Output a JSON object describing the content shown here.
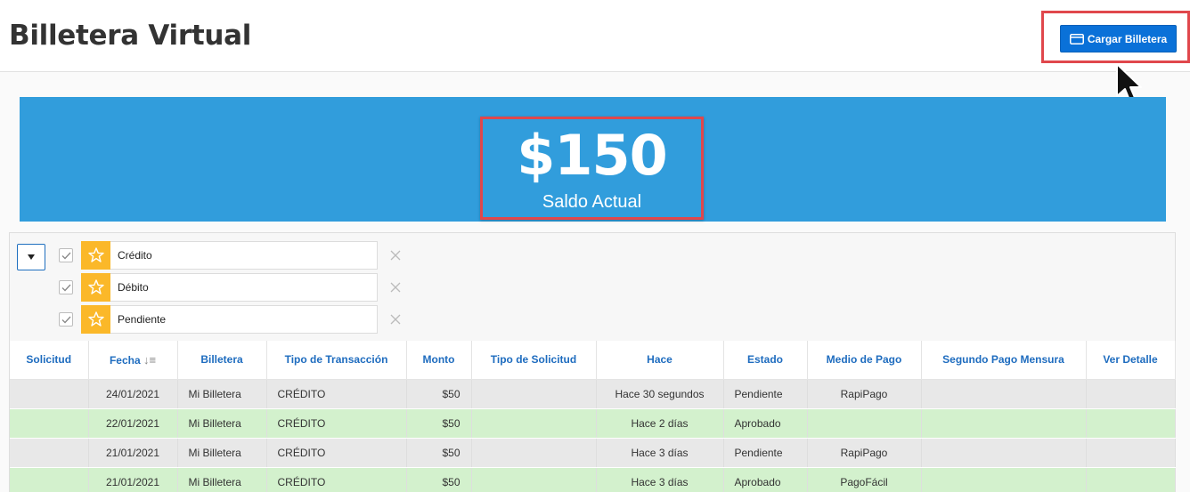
{
  "header": {
    "title": "Billetera Virtual",
    "cta_label": "Cargar Billetera"
  },
  "balance": {
    "amount": "$150",
    "label": "Saldo Actual"
  },
  "filters": [
    {
      "label": "Crédito"
    },
    {
      "label": "Débito"
    },
    {
      "label": "Pendiente"
    }
  ],
  "table": {
    "columns": [
      "Solicitud",
      "Fecha",
      "Billetera",
      "Tipo de Transacción",
      "Monto",
      "Tipo de Solicitud",
      "Hace",
      "Estado",
      "Medio de Pago",
      "Segundo Pago Mensura",
      "Ver Detalle"
    ],
    "rows": [
      {
        "solicitud": "",
        "fecha": "24/01/2021",
        "billetera": "Mi Billetera",
        "tipo": "CRÉDITO",
        "monto": "$50",
        "tipo_solicitud": "",
        "hace": "Hace 30 segundos",
        "estado": "Pendiente",
        "medio": "RapiPago",
        "segundo": "",
        "detalle": ""
      },
      {
        "solicitud": "",
        "fecha": "22/01/2021",
        "billetera": "Mi Billetera",
        "tipo": "CRÉDITO",
        "monto": "$50",
        "tipo_solicitud": "",
        "hace": "Hace 2 días",
        "estado": "Aprobado",
        "medio": "",
        "segundo": "",
        "detalle": ""
      },
      {
        "solicitud": "",
        "fecha": "21/01/2021",
        "billetera": "Mi Billetera",
        "tipo": "CRÉDITO",
        "monto": "$50",
        "tipo_solicitud": "",
        "hace": "Hace 3 días",
        "estado": "Pendiente",
        "medio": "RapiPago",
        "segundo": "",
        "detalle": ""
      },
      {
        "solicitud": "",
        "fecha": "21/01/2021",
        "billetera": "Mi Billetera",
        "tipo": "CRÉDITO",
        "monto": "$50",
        "tipo_solicitud": "",
        "hace": "Hace 3 días",
        "estado": "Aprobado",
        "medio": "PagoFácil",
        "segundo": "",
        "detalle": ""
      }
    ]
  },
  "colors": {
    "accent": "#0a71d8",
    "banner": "#319ddc",
    "highlight": "#e0474c",
    "star": "#fbb829",
    "pending_row": "#e8e8e8",
    "approved_row": "#d3f1cd"
  },
  "icons": {
    "cta": "credit-card-icon",
    "filter_toggle": "caret-down-icon",
    "filter_star": "star-icon",
    "filter_remove": "close-icon",
    "sort": "sort-descending-icon"
  }
}
